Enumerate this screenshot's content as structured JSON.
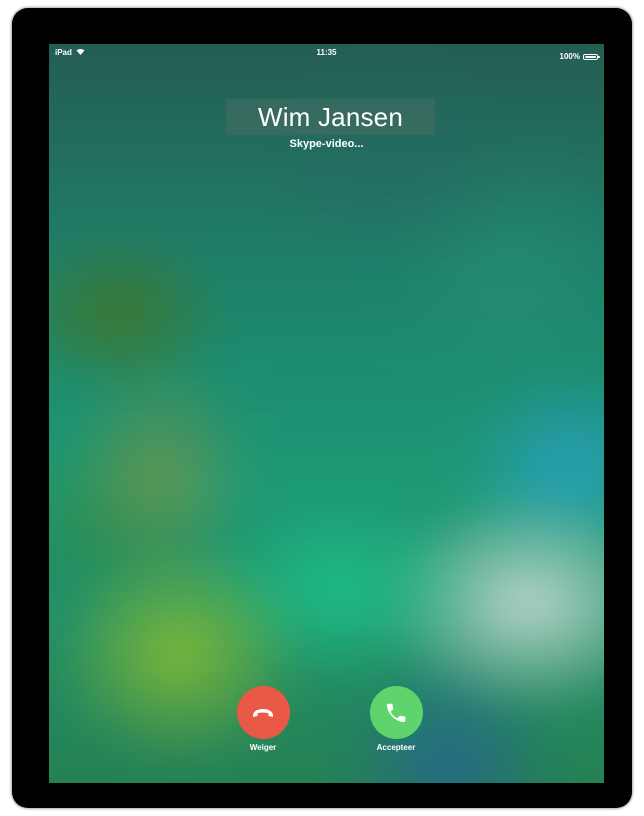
{
  "status_bar": {
    "device": "iPad",
    "time": "11:35",
    "battery_percent": "100%",
    "battery_level": 1.0,
    "icons": [
      "wifi-icon",
      "battery-icon"
    ]
  },
  "call": {
    "caller_name": "Wim Jansen",
    "call_type": "Skype-video...",
    "decline_label": "Weiger",
    "accept_label": "Accepteer"
  },
  "colors": {
    "decline": "#ea5848",
    "accept": "#5fd46c"
  }
}
